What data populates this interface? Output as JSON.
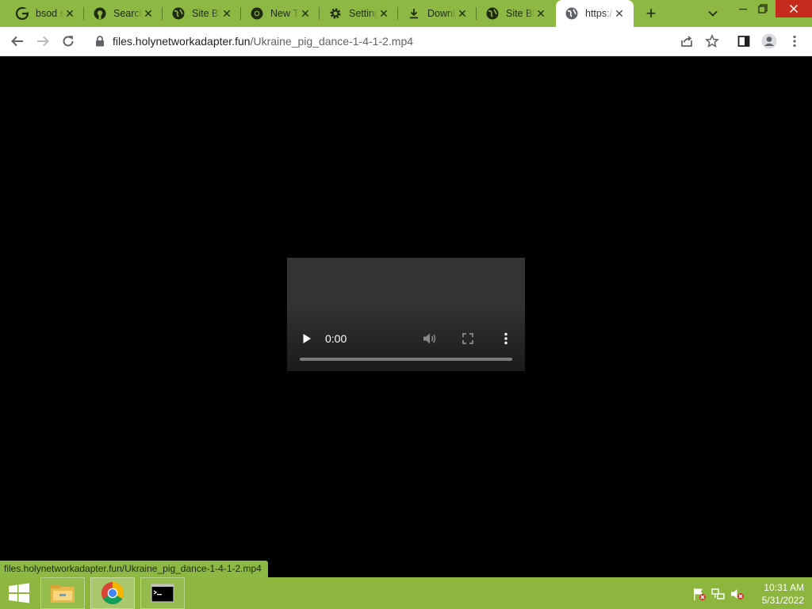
{
  "browser": {
    "tabs": [
      {
        "title": "bsod s",
        "icon": "google-icon"
      },
      {
        "title": "Search",
        "icon": "github-icon"
      },
      {
        "title": "Site Bl",
        "icon": "globe-icon"
      },
      {
        "title": "New T",
        "icon": "chrome-icon"
      },
      {
        "title": "Setting",
        "icon": "gear-icon"
      },
      {
        "title": "Downl",
        "icon": "download-icon"
      },
      {
        "title": "Site Bl",
        "icon": "globe-icon"
      },
      {
        "title": "https:/",
        "icon": "globe-icon",
        "active": true
      }
    ],
    "address": {
      "host": "files.holynetworkadapter.fun",
      "path": "/Ukraine_pig_dance-1-4-1-2.mp4"
    }
  },
  "video": {
    "current_time": "0:00",
    "progress": 0
  },
  "status_bar": {
    "url": "files.holynetworkadapter.fun/Ukraine_pig_dance-1-4-1-2.mp4"
  },
  "taskbar": {
    "apps": [
      "file-explorer-icon",
      "chrome-icon",
      "command-prompt-icon"
    ],
    "clock": {
      "time": "10:31 AM",
      "date": "5/31/2022"
    }
  },
  "colors": {
    "frame": "#8db843",
    "taskbar": "#8cb63e",
    "page_background": "#000000",
    "video_background": "#333333"
  }
}
